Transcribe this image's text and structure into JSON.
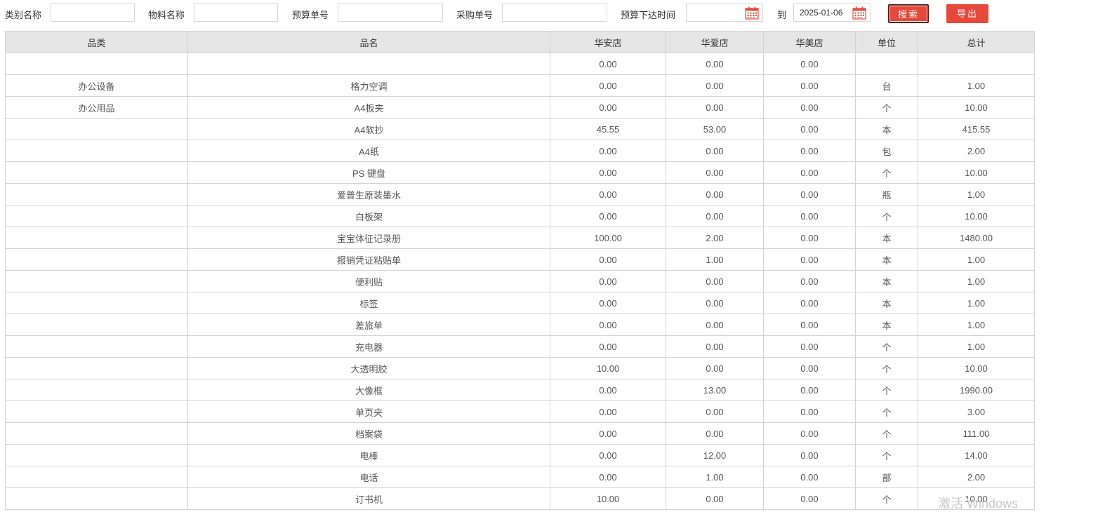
{
  "filters": {
    "category_label": "类别名称",
    "category_value": "",
    "material_label": "物料名称",
    "material_value": "",
    "budget_no_label": "预算单号",
    "budget_no_value": "",
    "purchase_no_label": "采购单号",
    "purchase_no_value": "",
    "budget_time_label": "预算下达时间",
    "date_from_value": "",
    "to_label": "到",
    "date_to_value": "2025-01-06",
    "search_label": "搜索",
    "export_label": "导出"
  },
  "table": {
    "headers": [
      "品类",
      "品名",
      "华安店",
      "华爱店",
      "华美店",
      "单位",
      "总计"
    ],
    "rows": [
      [
        "",
        "",
        "0.00",
        "0.00",
        "0.00",
        "",
        ""
      ],
      [
        "办公设备",
        "格力空调",
        "0.00",
        "0.00",
        "0.00",
        "台",
        "1.00"
      ],
      [
        "办公用品",
        "A4板夹",
        "0.00",
        "0.00",
        "0.00",
        "个",
        "10.00"
      ],
      [
        "",
        "A4软抄",
        "45.55",
        "53.00",
        "0.00",
        "本",
        "415.55"
      ],
      [
        "",
        "A4纸",
        "0.00",
        "0.00",
        "0.00",
        "包",
        "2.00"
      ],
      [
        "",
        "PS 键盘",
        "0.00",
        "0.00",
        "0.00",
        "个",
        "10.00"
      ],
      [
        "",
        "爱普生原装墨水",
        "0.00",
        "0.00",
        "0.00",
        "瓶",
        "1.00"
      ],
      [
        "",
        "白板架",
        "0.00",
        "0.00",
        "0.00",
        "个",
        "10.00"
      ],
      [
        "",
        "宝宝体征记录册",
        "100.00",
        "2.00",
        "0.00",
        "本",
        "1480.00"
      ],
      [
        "",
        "报销凭证粘贴单",
        "0.00",
        "1.00",
        "0.00",
        "本",
        "1.00"
      ],
      [
        "",
        "便利贴",
        "0.00",
        "0.00",
        "0.00",
        "本",
        "1.00"
      ],
      [
        "",
        "标签",
        "0.00",
        "0.00",
        "0.00",
        "本",
        "1.00"
      ],
      [
        "",
        "差旅单",
        "0.00",
        "0.00",
        "0.00",
        "本",
        "1.00"
      ],
      [
        "",
        "充电器",
        "0.00",
        "0.00",
        "0.00",
        "个",
        "1.00"
      ],
      [
        "",
        "大透明胶",
        "10.00",
        "0.00",
        "0.00",
        "个",
        "10.00"
      ],
      [
        "",
        "大像框",
        "0.00",
        "13.00",
        "0.00",
        "个",
        "1990.00"
      ],
      [
        "",
        "单页夹",
        "0.00",
        "0.00",
        "0.00",
        "个",
        "3.00"
      ],
      [
        "",
        "档案袋",
        "0.00",
        "0.00",
        "0.00",
        "个",
        "111.00"
      ],
      [
        "",
        "电棒",
        "0.00",
        "12.00",
        "0.00",
        "个",
        "14.00"
      ],
      [
        "",
        "电话",
        "0.00",
        "1.00",
        "0.00",
        "部",
        "2.00"
      ],
      [
        "",
        "订书机",
        "10.00",
        "0.00",
        "0.00",
        "个",
        "10.00"
      ]
    ]
  },
  "watermark_text": "激活 Windows",
  "colors": {
    "accent": "#e8483a",
    "header_bg": "#e6e6e6",
    "border": "#d2d2d2",
    "calendar_icon": "#e8483a"
  },
  "icons": {
    "calendar": "calendar-icon"
  }
}
